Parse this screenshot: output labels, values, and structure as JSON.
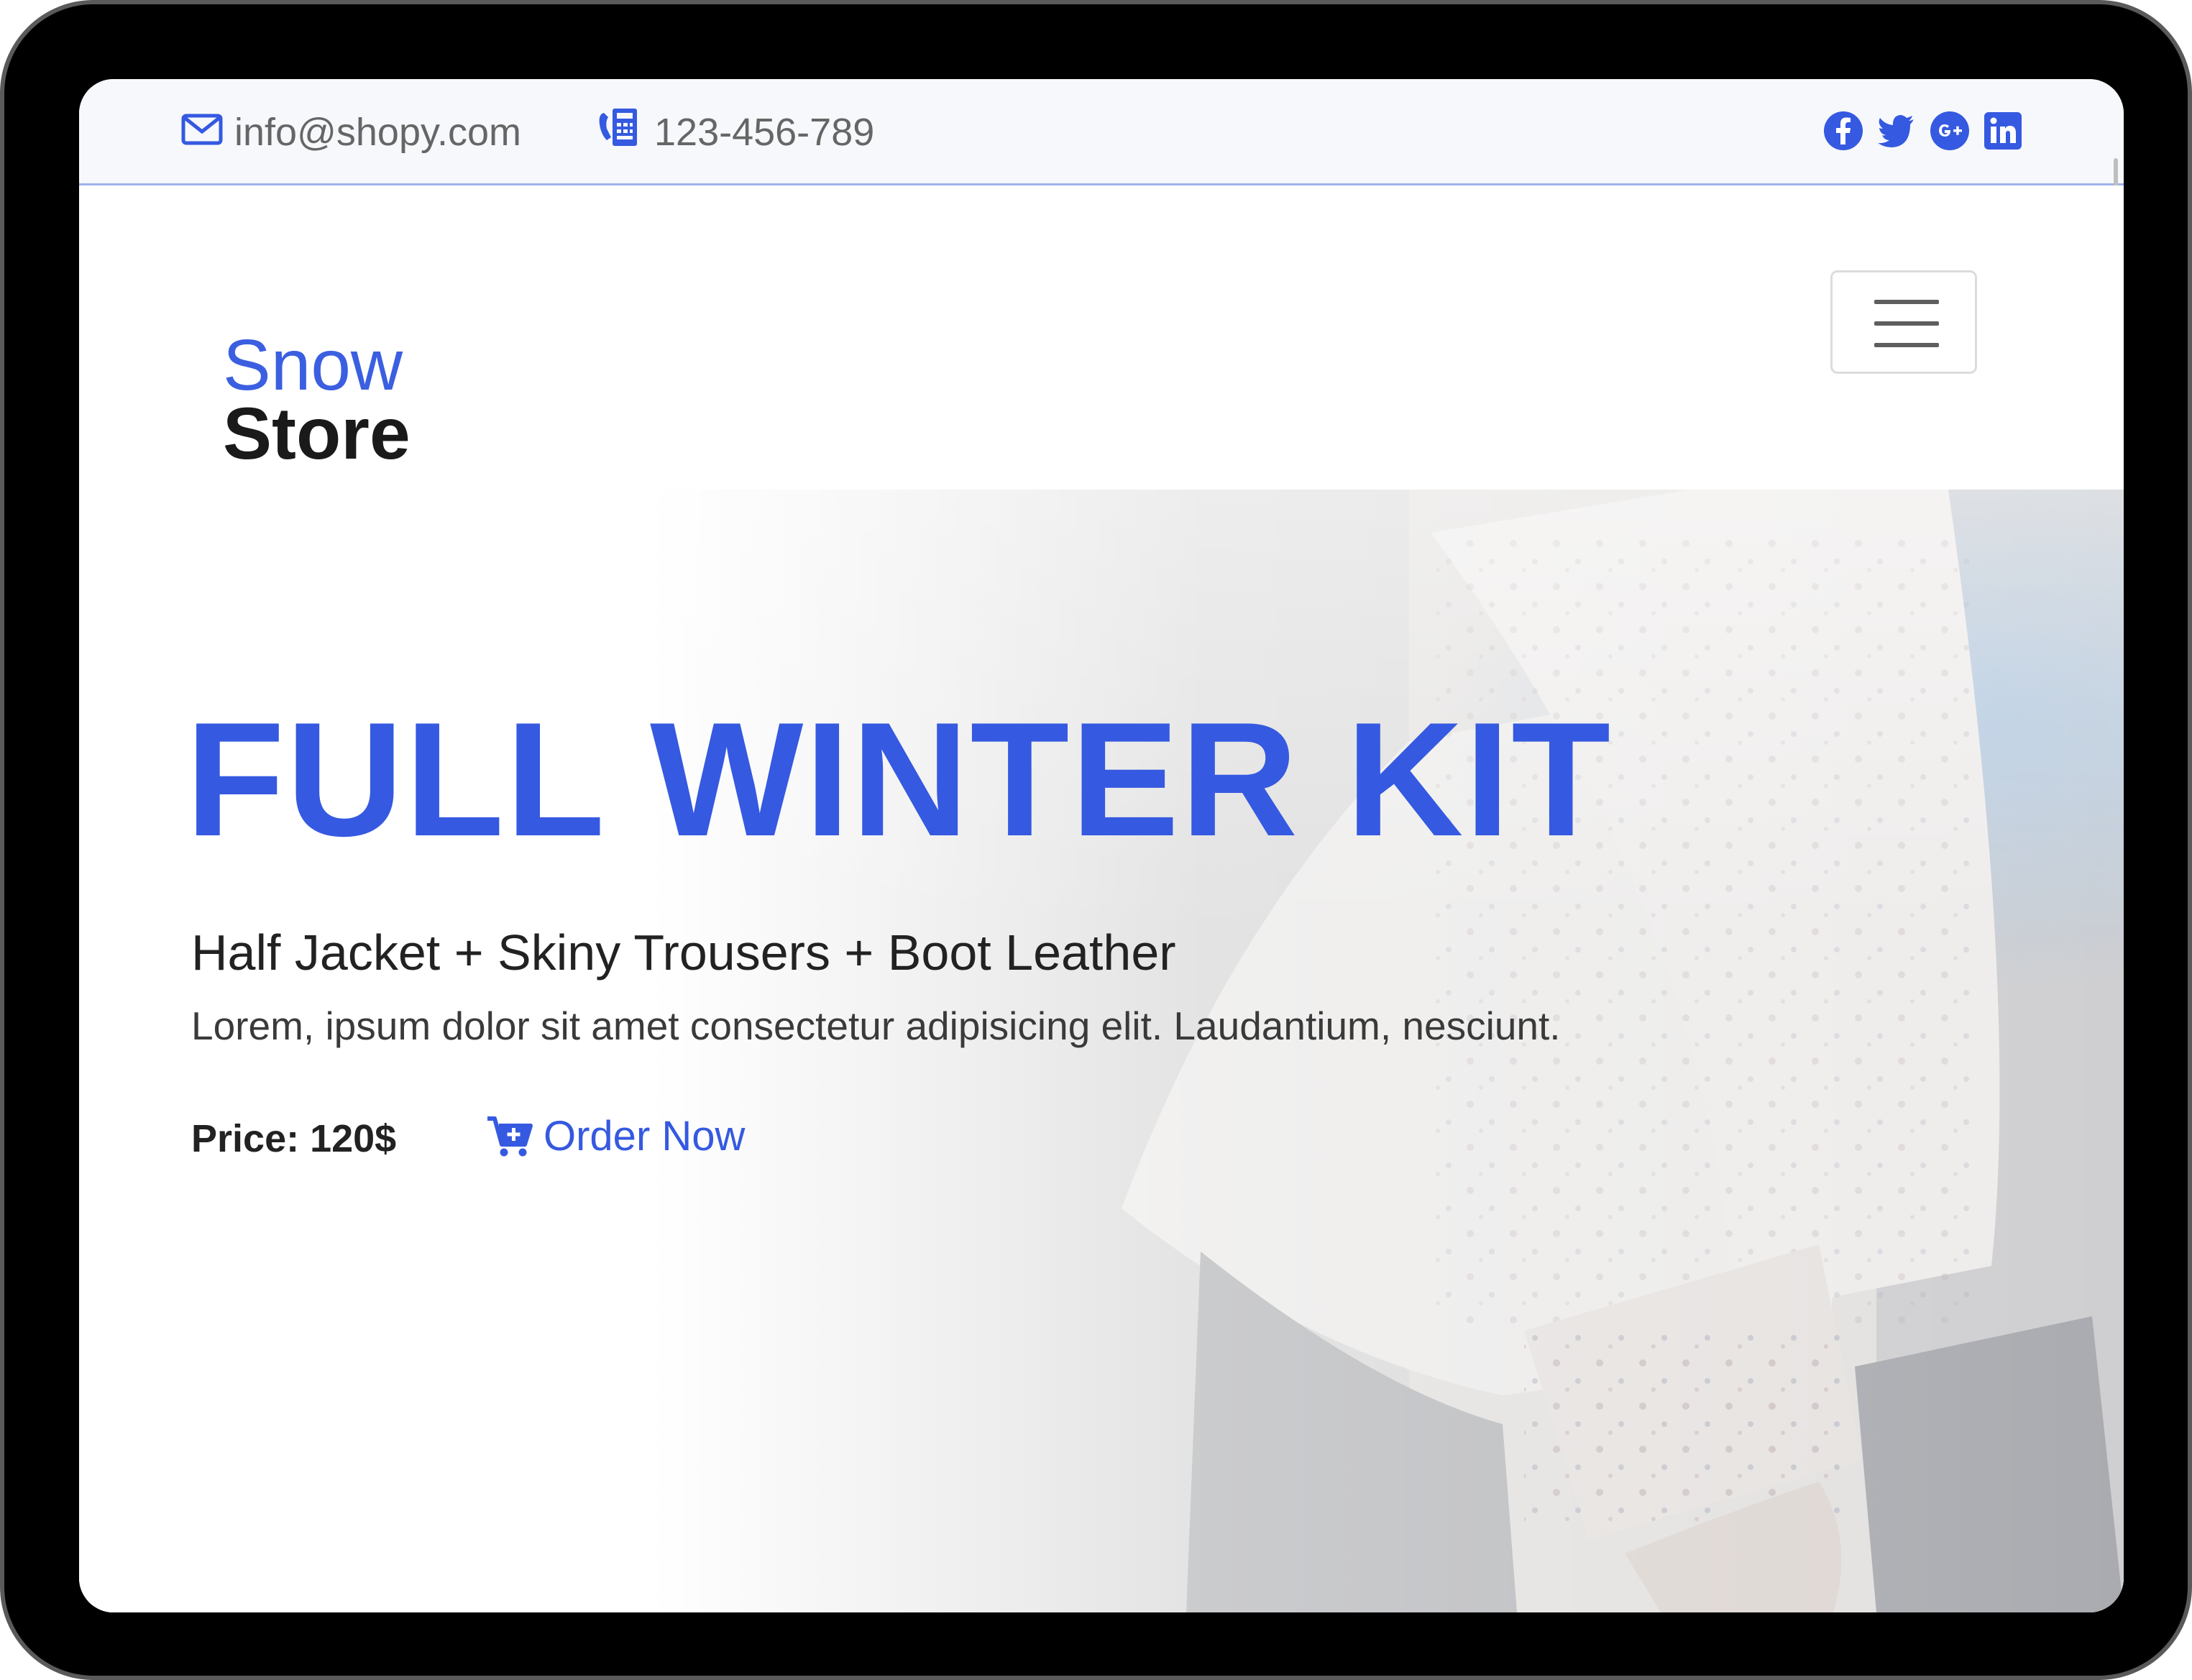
{
  "topbar": {
    "email": "info@shopy.com",
    "phone": "123-456-789",
    "socials": [
      {
        "name": "facebook-icon"
      },
      {
        "name": "twitter-icon"
      },
      {
        "name": "google-plus-icon"
      },
      {
        "name": "linkedin-icon"
      }
    ]
  },
  "navbar": {
    "brand_top": "Snow",
    "brand_bottom": "Store"
  },
  "hero": {
    "title": "FULL WINTER KIT",
    "subtitle": "Half Jacket + Skiny Trousers + Boot Leather",
    "description": "Lorem, ipsum dolor sit amet consectetur adipisicing elit. Laudantium, nesciunt.",
    "price": "Price: 120$",
    "order_label": "Order Now"
  },
  "colors": {
    "accent": "#3559e0",
    "brand_blue": "#3b5fe0",
    "topbar_bg": "#f6f8fc",
    "text_dark": "#222222"
  }
}
